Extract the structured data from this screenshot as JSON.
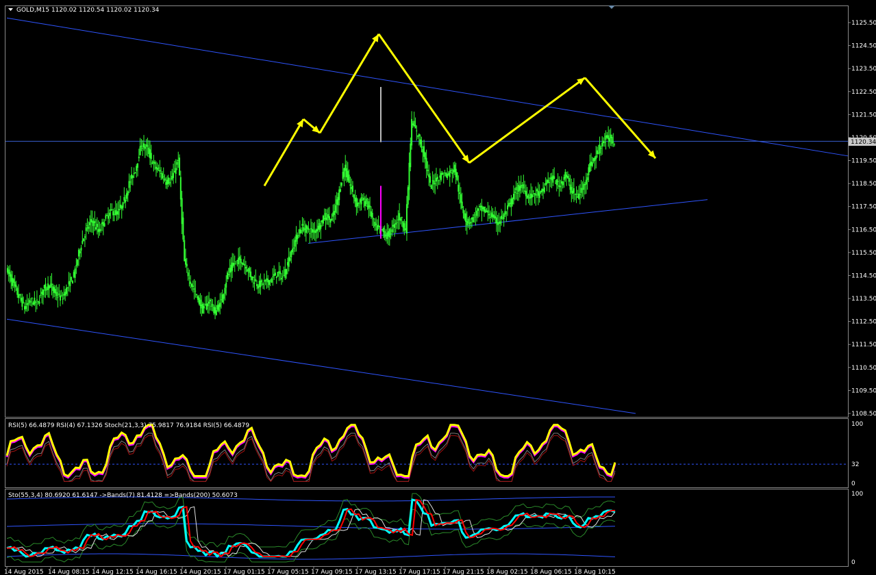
{
  "main": {
    "header": "GOLD,M15  1120.02 1120.54 1120.02 1120.34",
    "current_price": "1120.34"
  },
  "rsi_panel": {
    "header": "RSI(5) 66.4879  RSI(4) 67.1326  Stoch(21,3,3) 75.9817 76.9184  RSI(5) 66.4879",
    "tick_labels": [
      "100",
      "32",
      "0"
    ]
  },
  "sto_panel": {
    "header": "Sto(55,3,4) 80.6920 61.6147  ->Bands(7) 81.4128  =>Bands(200) 50.6073",
    "tick_labels": [
      "100",
      "0"
    ]
  },
  "colors": {
    "background": "#000000",
    "candle": "#33ff33",
    "trendline": "#2f55ff",
    "zigzag": "#ffff00",
    "rsi": "#ffff00",
    "rsi_shadow": "#ff00ff",
    "sto_main": "#ff0000",
    "sto_signal": "#00ffff",
    "bands": "#2f55ff",
    "spike": "#ff00ff"
  },
  "chart_data": [
    {
      "type": "candlestick",
      "symbol": "GOLD",
      "timeframe": "M15",
      "ohlc_last": {
        "open": 1120.02,
        "high": 1120.54,
        "low": 1120.02,
        "close": 1120.34
      },
      "ylim": [
        1108.5,
        1126.0
      ],
      "y_ticks": [
        "1125.50",
        "1124.50",
        "1123.50",
        "1122.50",
        "1121.50",
        "1120.50",
        "1119.50",
        "1118.50",
        "1117.50",
        "1116.50",
        "1115.50",
        "1114.50",
        "1113.50",
        "1112.50",
        "1111.50",
        "1110.50",
        "1109.50",
        "1108.50"
      ],
      "x_ticks": [
        "14 Aug 2015",
        "14 Aug 08:15",
        "14 Aug 12:15",
        "14 Aug 16:15",
        "14 Aug 20:15",
        "17 Aug 01:15",
        "17 Aug 05:15",
        "17 Aug 09:15",
        "17 Aug 13:15",
        "17 Aug 17:15",
        "17 Aug 21:15",
        "18 Aug 02:15",
        "18 Aug 06:15",
        "18 Aug 10:15"
      ],
      "close_series": [
        1114.8,
        1114.2,
        1113.6,
        1113.1,
        1113.4,
        1113.3,
        1113.9,
        1114.1,
        1113.7,
        1113.5,
        1114.0,
        1114.5,
        1115.7,
        1116.5,
        1116.9,
        1116.4,
        1116.9,
        1117.3,
        1117.2,
        1117.6,
        1118.5,
        1119.1,
        1120.2,
        1120.0,
        1119.3,
        1119.0,
        1118.6,
        1118.7,
        1119.6,
        1115.1,
        1114.2,
        1113.6,
        1113.0,
        1113.4,
        1112.9,
        1113.4,
        1114.5,
        1115.0,
        1115.2,
        1114.9,
        1114.4,
        1114.1,
        1114.2,
        1114.3,
        1114.6,
        1114.4,
        1115.2,
        1116.0,
        1116.6,
        1116.5,
        1116.4,
        1116.7,
        1117.1,
        1116.9,
        1117.9,
        1119.2,
        1118.4,
        1117.6,
        1117.8,
        1117.5,
        1116.6,
        1116.5,
        1116.2,
        1116.6,
        1117.1,
        1116.5,
        1121.2,
        1120.6,
        1119.8,
        1118.4,
        1118.7,
        1118.9,
        1118.9,
        1119.2,
        1117.6,
        1116.8,
        1117.0,
        1117.4,
        1117.3,
        1117.1,
        1116.8,
        1117.1,
        1117.6,
        1118.2,
        1118.4,
        1117.9,
        1118.1,
        1118.0,
        1118.6,
        1118.7,
        1118.4,
        1118.9,
        1118.2,
        1117.9,
        1118.4,
        1119.3,
        1119.7,
        1120.3,
        1120.5,
        1120.3
      ],
      "spike": {
        "low": 1116.1,
        "high": 1122.7
      },
      "zigzag_projection": [
        1118.4,
        1121.3,
        1120.7,
        1125.0,
        1119.4,
        1123.1,
        1119.6
      ],
      "trendlines": [
        {
          "name": "channel-top",
          "from": 1125.7,
          "to": 1119.7
        },
        {
          "name": "channel-bottom",
          "from": 1112.6,
          "to": 1108.5
        },
        {
          "name": "support",
          "from": 1115.9,
          "to": 1117.8
        },
        {
          "name": "price-level",
          "from": 1120.34,
          "to": 1120.34
        }
      ]
    },
    {
      "type": "line",
      "name": "RSI / Stoch",
      "ylim": [
        0,
        100
      ],
      "levels": [
        32
      ],
      "series": [
        {
          "name": "RSI(5)",
          "last": 66.4879
        },
        {
          "name": "RSI(4)",
          "last": 67.1326
        },
        {
          "name": "Stoch(21,3,3)",
          "last": [
            75.9817,
            76.9184
          ]
        }
      ]
    },
    {
      "type": "line",
      "name": "Sto / Bands",
      "ylim": [
        0,
        100
      ],
      "series": [
        {
          "name": "Sto(55,3,4)",
          "last": [
            80.692,
            61.6147
          ]
        },
        {
          "name": "Bands(7)",
          "last": 81.4128
        },
        {
          "name": "Bands(200)",
          "last": 50.6073
        }
      ]
    }
  ]
}
